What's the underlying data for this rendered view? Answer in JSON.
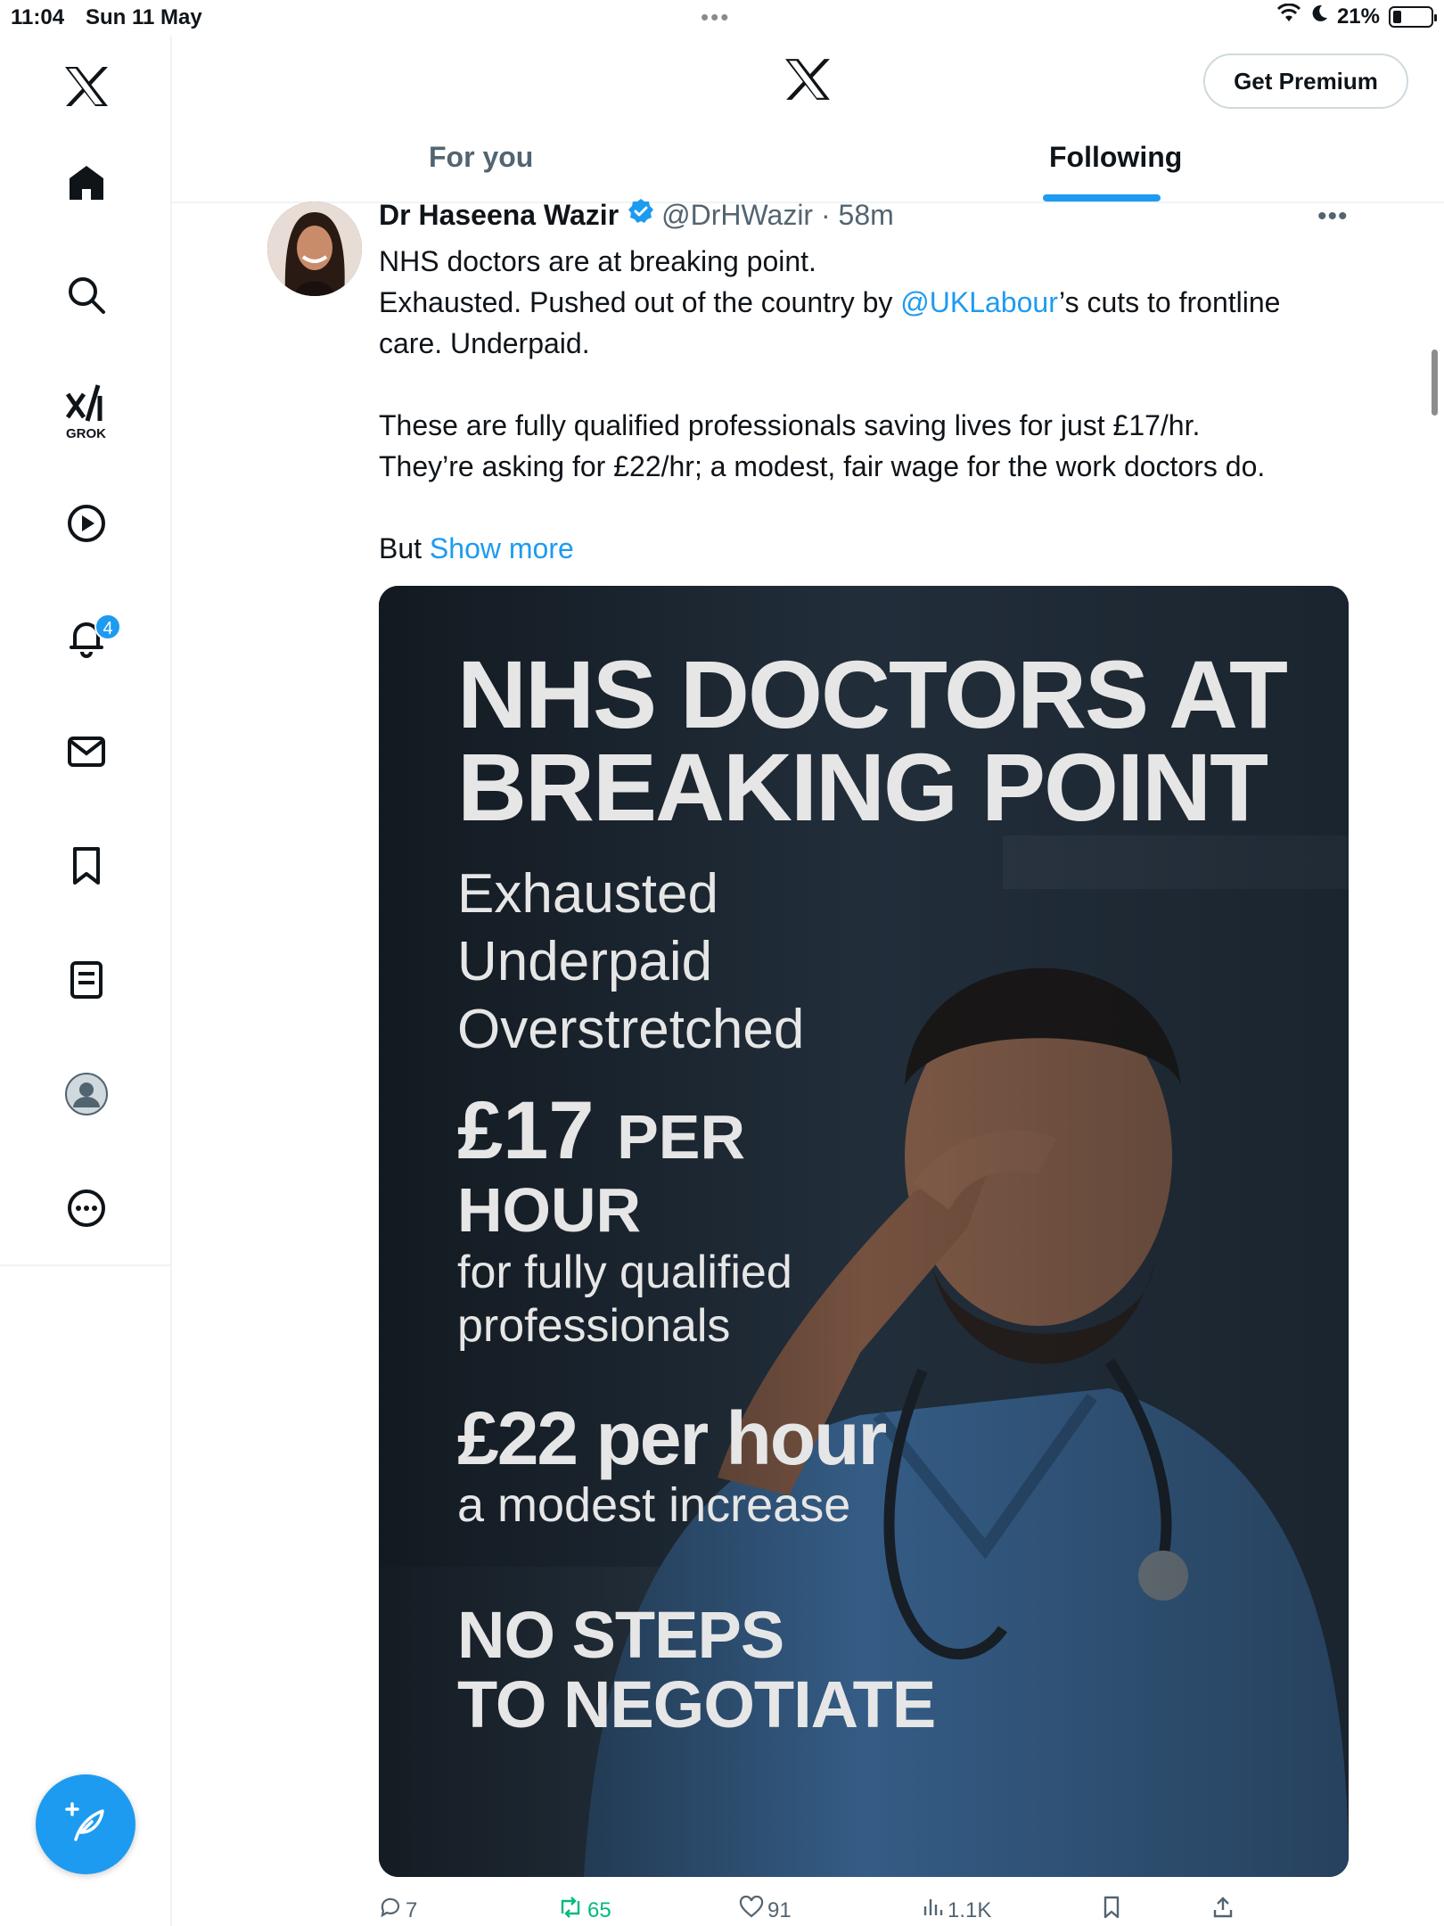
{
  "status_bar": {
    "time": "11:04",
    "date": "Sun 11 May",
    "battery": "21%"
  },
  "sidebar": {
    "items": [
      {
        "name": "home"
      },
      {
        "name": "explore"
      },
      {
        "name": "grok",
        "label": "GROK"
      },
      {
        "name": "videos"
      },
      {
        "name": "notifications",
        "badge": "4"
      },
      {
        "name": "messages"
      },
      {
        "name": "bookmarks"
      },
      {
        "name": "lists"
      },
      {
        "name": "profile"
      },
      {
        "name": "more"
      }
    ]
  },
  "header": {
    "premium_label": "Get Premium",
    "tabs": [
      {
        "label": "For you",
        "active": false
      },
      {
        "label": "Following",
        "active": true
      }
    ]
  },
  "tweet": {
    "author_name": "Dr Haseena Wazir",
    "handle": "@DrHWazir",
    "time": "58m",
    "text": {
      "line1": "NHS doctors are at breaking point.",
      "line2_pre": "Exhausted. Pushed out of the country by ",
      "line2_mention": "@UKLabour",
      "line2_post": "’s cuts to frontline care. Underpaid.",
      "para2_line1": "These are fully qualified professionals saving lives for just £17/hr.",
      "para2_line2": "They’re asking for £22/hr; a modest, fair wage for the work doctors do.",
      "para3_pre": "But",
      "show_more": "Show more"
    },
    "media": {
      "title_line1": "NHS DOCTORS AT",
      "title_line2": "BREAKING POINT",
      "sub1": "Exhausted",
      "sub2": "Underpaid",
      "sub3": "Overstretched",
      "rate17": "£17",
      "rate17_per": "PER",
      "rate17_hour": "HOUR",
      "qual1": "for fully qualified",
      "qual2": "professionals",
      "rate22": "£22 per hour",
      "increase": "a modest increase",
      "neg1": "NO STEPS",
      "neg2": "TO NEGOTIATE"
    },
    "actions": {
      "replies": "7",
      "reposts": "65",
      "likes": "91",
      "views": "1.1K"
    }
  },
  "colors": {
    "accent": "#1d9bf0",
    "retweet": "#00ba7c",
    "muted": "#536471",
    "text": "#0f1419"
  }
}
